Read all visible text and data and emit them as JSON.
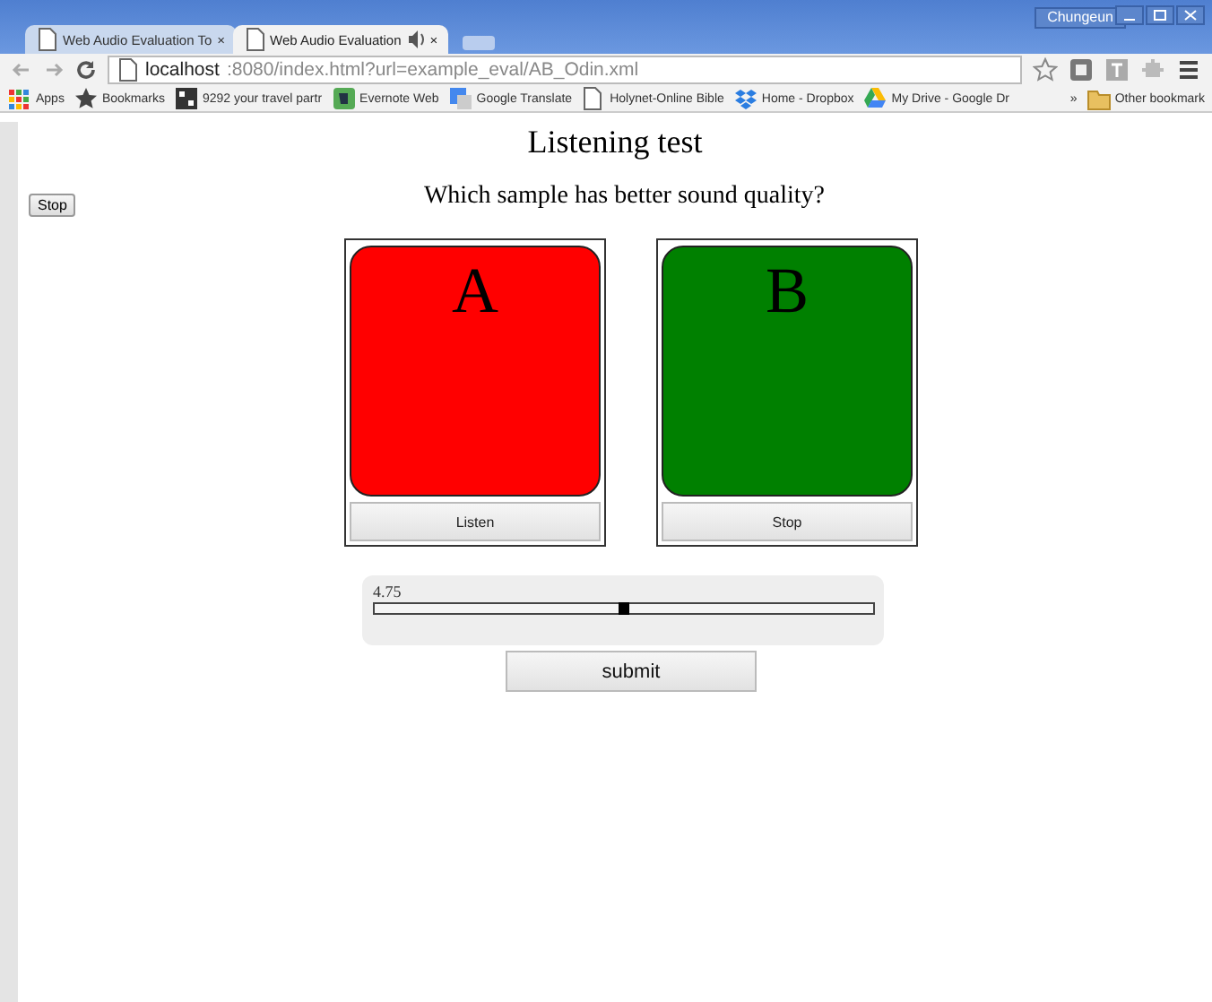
{
  "window": {
    "user": "Chungeun"
  },
  "tabs": [
    {
      "title": "Web Audio Evaluation To",
      "close": "×",
      "selected": false,
      "audio": false
    },
    {
      "title": "Web Audio Evaluation",
      "close": "×",
      "selected": true,
      "audio": true
    }
  ],
  "address_bar": {
    "host": "localhost",
    "rest": ":8080/index.html?url=example_eval/AB_Odin.xml"
  },
  "bookmarks": [
    {
      "label": "Apps",
      "kind": "apps"
    },
    {
      "label": "Bookmarks",
      "kind": "star"
    },
    {
      "label": "9292 your travel partr",
      "kind": "site"
    },
    {
      "label": "Evernote Web",
      "kind": "evernote"
    },
    {
      "label": "Google Translate",
      "kind": "translate"
    },
    {
      "label": "Holynet-Online Bible",
      "kind": "page"
    },
    {
      "label": "Home - Dropbox",
      "kind": "dropbox"
    },
    {
      "label": "My Drive - Google Dr",
      "kind": "drive"
    }
  ],
  "bookmarks_overflow": "»",
  "other_bookmarks": "Other bookmark",
  "page": {
    "title": "Listening test",
    "stop_button": "Stop",
    "question": "Which sample has better sound quality?",
    "samples": [
      {
        "letter": "A",
        "color": "#ff0000",
        "button": "Listen"
      },
      {
        "letter": "B",
        "color": "#008000",
        "button": "Stop"
      }
    ],
    "slider": {
      "reading": "4.75",
      "level": 0.5
    },
    "submit": "submit"
  }
}
